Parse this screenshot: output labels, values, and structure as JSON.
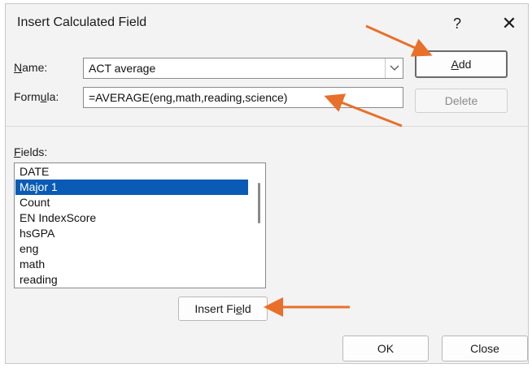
{
  "dialog": {
    "title": "Insert Calculated Field",
    "help_label": "?",
    "close_glyph": "✕",
    "help_icon": "question-mark",
    "close_icon": "close-x"
  },
  "name_row": {
    "label_underlined": "N",
    "label_rest": "ame:",
    "value": "ACT average"
  },
  "formula_row": {
    "label_pre": "Form",
    "label_underlined": "u",
    "label_rest": "la:",
    "value": "=AVERAGE(eng,math,reading,science)"
  },
  "buttons": {
    "add_underlined": "A",
    "add_rest": "dd",
    "delete": "Delete",
    "insert_field_pre": "Insert Fi",
    "insert_field_underlined": "e",
    "insert_field_rest": "ld",
    "ok": "OK",
    "close": "Close"
  },
  "fields": {
    "label_underlined": "F",
    "label_rest": "ields:",
    "items": [
      "DATE",
      "Major 1",
      "Count",
      "EN IndexScore",
      "hsGPA",
      "eng",
      "math",
      "reading"
    ],
    "selected": "Major 1"
  },
  "colors": {
    "annotation_arrow": "#e8702a",
    "selection": "#0a5bb5"
  }
}
